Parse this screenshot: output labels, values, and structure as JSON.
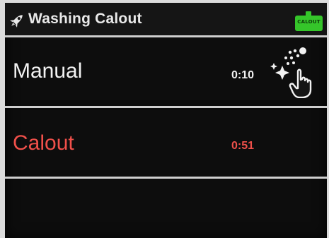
{
  "header": {
    "title": "Washing Calout",
    "title_icon": "rocket-icon",
    "badge": {
      "label": "CALOUT",
      "icon": "battery-icon",
      "color": "#35c52a"
    }
  },
  "programs": [
    {
      "label": "Manual",
      "time": "0:10",
      "color": "#f2f2f2",
      "icon": "spray-hand-icon"
    },
    {
      "label": "Calout",
      "time": "0:51",
      "color": "#f0504a"
    }
  ]
}
